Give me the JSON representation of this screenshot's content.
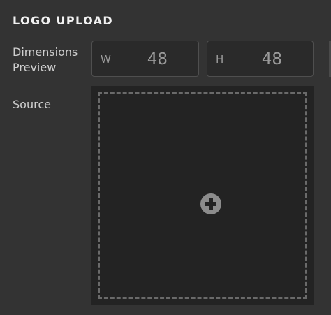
{
  "section": {
    "title": "LOGO UPLOAD"
  },
  "dimensions": {
    "label": "Dimensions\nPreview",
    "width_letter": "W",
    "width_value": "48",
    "height_letter": "H",
    "height_value": "48"
  },
  "source": {
    "label": "Source",
    "icon": "plus-circle-icon"
  },
  "colors": {
    "background": "#333333",
    "input_bg": "#2a2a2a",
    "dropzone_bg": "#232323",
    "dashed_border": "#6a6a6a",
    "text_primary": "#f2f2f2",
    "text_secondary": "#cfcfcf",
    "text_muted": "#9a9a9a"
  }
}
